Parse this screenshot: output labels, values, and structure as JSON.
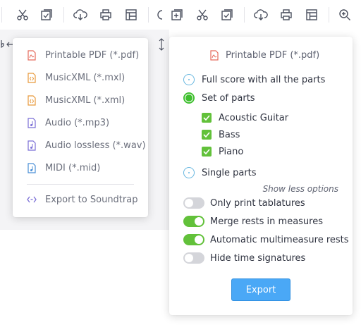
{
  "export_menu": {
    "items": [
      {
        "label": "Printable PDF (*.pdf)",
        "icon": "pdf-file-icon"
      },
      {
        "label": "MusicXML (*.mxl)",
        "icon": "xml-file-icon"
      },
      {
        "label": "MusicXML (*.xml)",
        "icon": "xml-file-icon"
      },
      {
        "label": "Audio (*.mp3)",
        "icon": "audio-file-icon"
      },
      {
        "label": "Audio lossless (*.wav)",
        "icon": "audio-file-icon"
      },
      {
        "label": "MIDI (*.mid)",
        "icon": "midi-file-icon"
      }
    ],
    "soundtrap_label": "Export to Soundtrap"
  },
  "export_panel": {
    "format_label": "Printable PDF (*.pdf)",
    "radio_full_score": "Full score with all the parts",
    "radio_set_of_parts": "Set of parts",
    "parts": [
      "Acoustic Guitar",
      "Bass",
      "Piano"
    ],
    "radio_single_parts": "Single parts",
    "show_less": "Show less options",
    "options": [
      {
        "label": "Only print tablatures",
        "on": false
      },
      {
        "label": "Merge rests in measures",
        "on": true
      },
      {
        "label": "Automatic multimeasure rests",
        "on": true
      },
      {
        "label": "Hide time signatures",
        "on": false
      }
    ],
    "export_button": "Export"
  },
  "colors": {
    "accent_green": "#62c13a",
    "accent_blue": "#4aa8f6",
    "pdf_red": "#e56a5c",
    "xml_orange": "#e89a3c",
    "audio_purple": "#7b6fd6",
    "text_muted": "#6b6f7c"
  }
}
